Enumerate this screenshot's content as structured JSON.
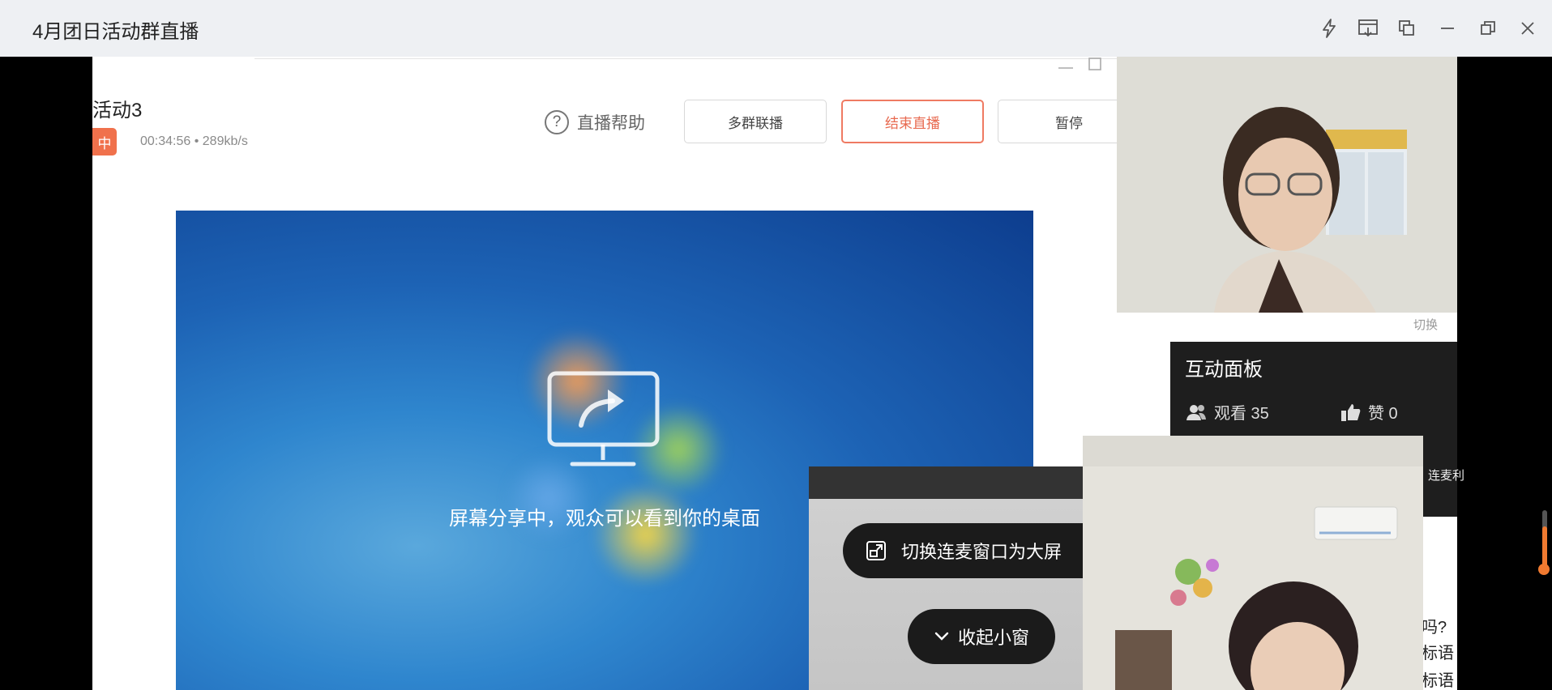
{
  "window": {
    "title": "4月团日活动群直播",
    "controls": [
      "lightning-icon",
      "screen-pin-icon",
      "copy-icon",
      "minimize-icon",
      "restore-icon",
      "close-icon"
    ]
  },
  "live": {
    "title": "活动3",
    "badge": "中",
    "stats": "00:34:56  •  289kb/s",
    "help_label": "直播帮助",
    "buttons": {
      "multi_group": "多群联播",
      "end": "结束直播",
      "pause": "暂停"
    },
    "share_text": "屏幕分享中，观众可以看到你的桌面"
  },
  "panel": {
    "switch_label": "切换",
    "title": "互动面板",
    "views": "观看 35",
    "likes": "赞 0",
    "lianmai": "连麦利",
    "chat": [
      "吗?",
      "标语",
      "标语"
    ]
  },
  "mini": {
    "switch_label": "切换连麦窗口为大屏",
    "collapse_label": "收起小窗"
  },
  "colors": {
    "accent_end": "#e86a50",
    "badge": "#f0714c",
    "volume": "#f07a30"
  }
}
